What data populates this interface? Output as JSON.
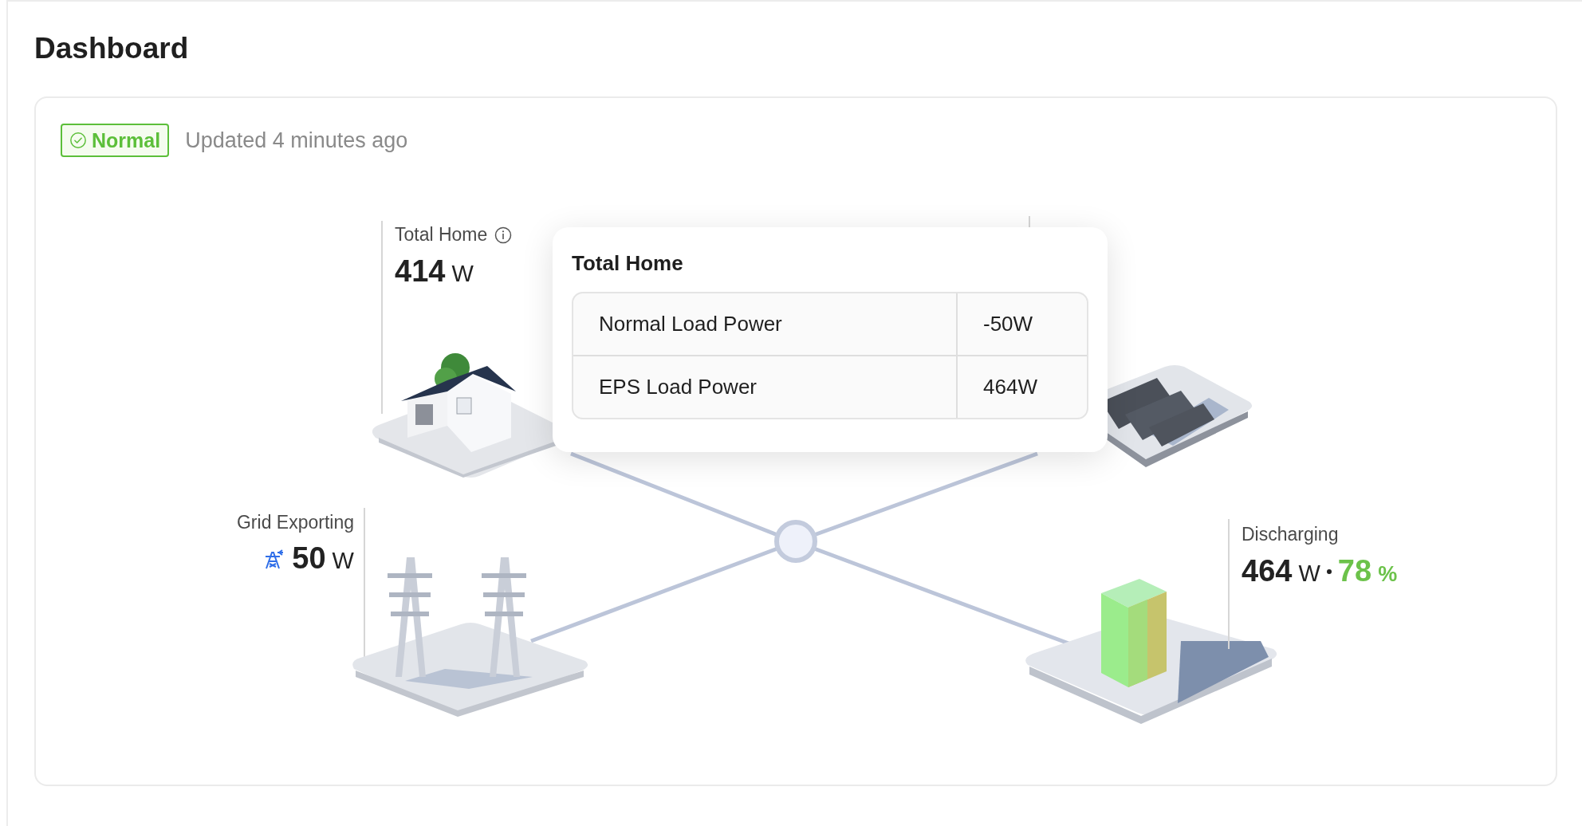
{
  "page_title": "Dashboard",
  "status": {
    "label": "Normal",
    "kind": "normal"
  },
  "updated": "Updated 4 minutes ago",
  "nodes": [
    {
      "kind": "home",
      "label": "Total Home",
      "value": "414",
      "unit": "W",
      "info": true
    },
    {
      "kind": "solar"
    },
    {
      "kind": "grid",
      "label": "Grid Exporting",
      "value": "50",
      "unit": "W"
    },
    {
      "kind": "battery",
      "label": "Discharging",
      "value": "464",
      "unit": "W",
      "percent": "78",
      "percent_unit": "%"
    }
  ],
  "tooltip": {
    "title": "Total Home",
    "rows": [
      {
        "label": "Normal Load Power",
        "value": "-50W"
      },
      {
        "label": "EPS Load Power",
        "value": "464W"
      }
    ]
  }
}
